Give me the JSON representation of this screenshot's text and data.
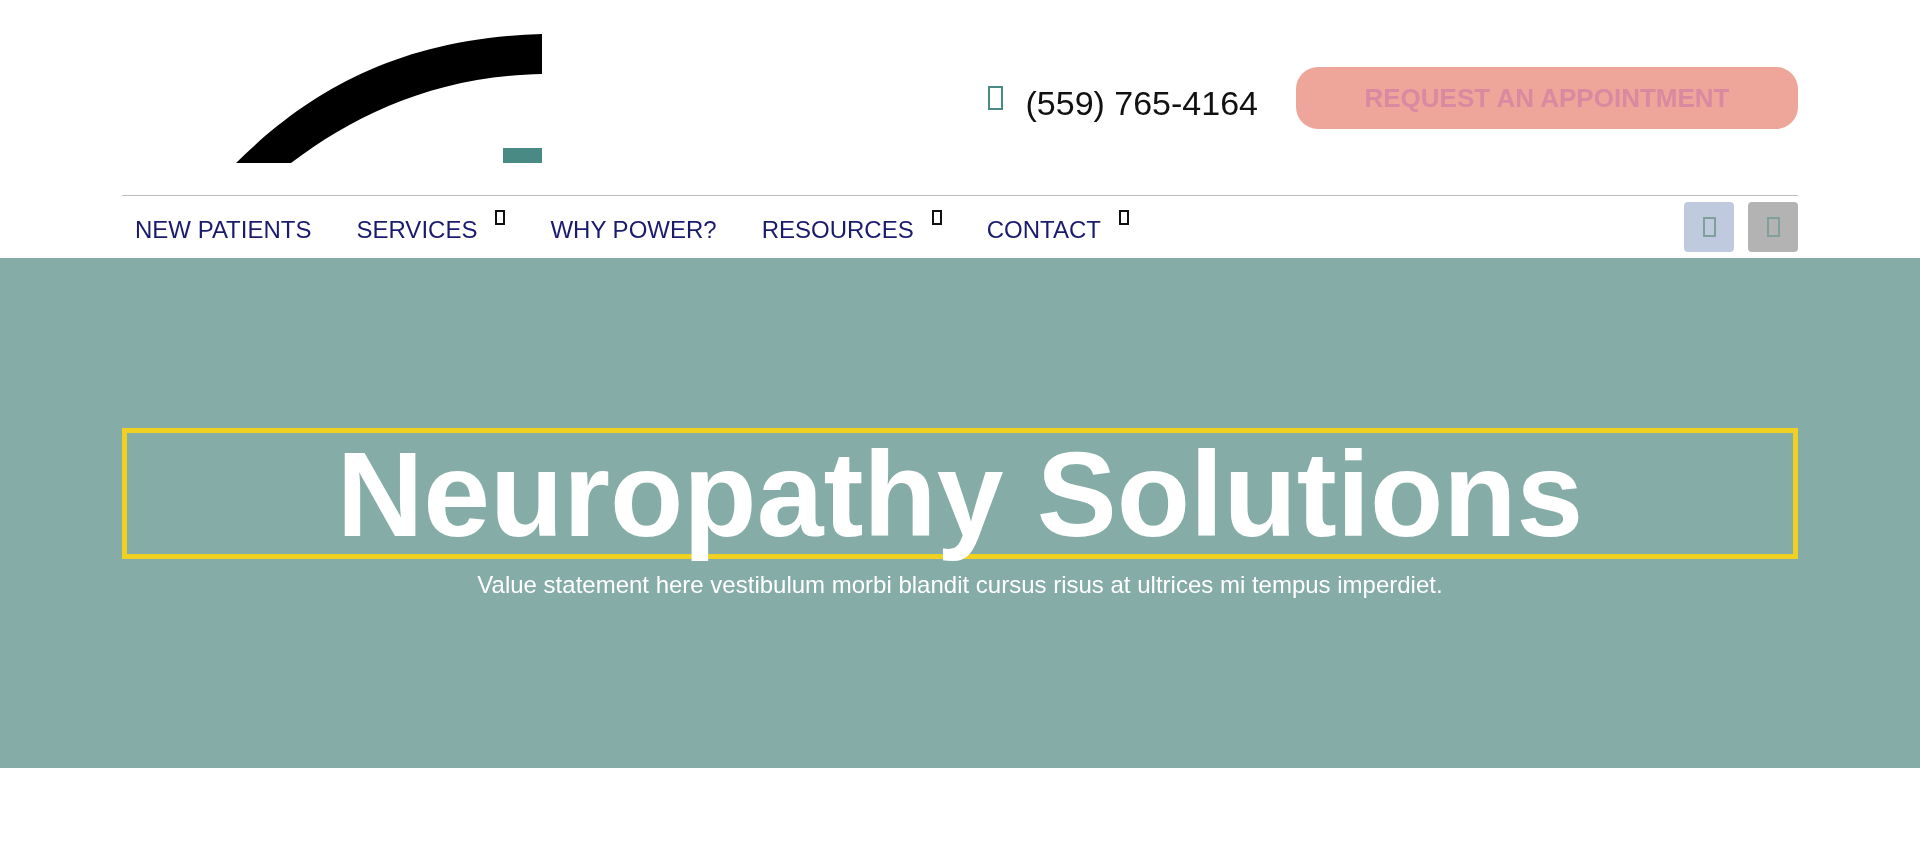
{
  "header": {
    "phone": "(559) 765-4164",
    "cta_button": "REQUEST AN APPOINTMENT"
  },
  "nav": {
    "items": [
      {
        "label": "NEW PATIENTS",
        "has_submenu": false
      },
      {
        "label": "SERVICES",
        "has_submenu": true
      },
      {
        "label": "WHY POWER?",
        "has_submenu": false
      },
      {
        "label": "RESOURCES",
        "has_submenu": true
      },
      {
        "label": "CONTACT",
        "has_submenu": true
      }
    ],
    "social_buttons": [
      {
        "color": "#bfcadf"
      },
      {
        "color": "#b3b3b3"
      }
    ]
  },
  "hero": {
    "title": "Neuropathy Solutions",
    "subtitle": "Value statement here vestibulum morbi blandit cursus risus at ultrices mi tempus imperdiet."
  }
}
